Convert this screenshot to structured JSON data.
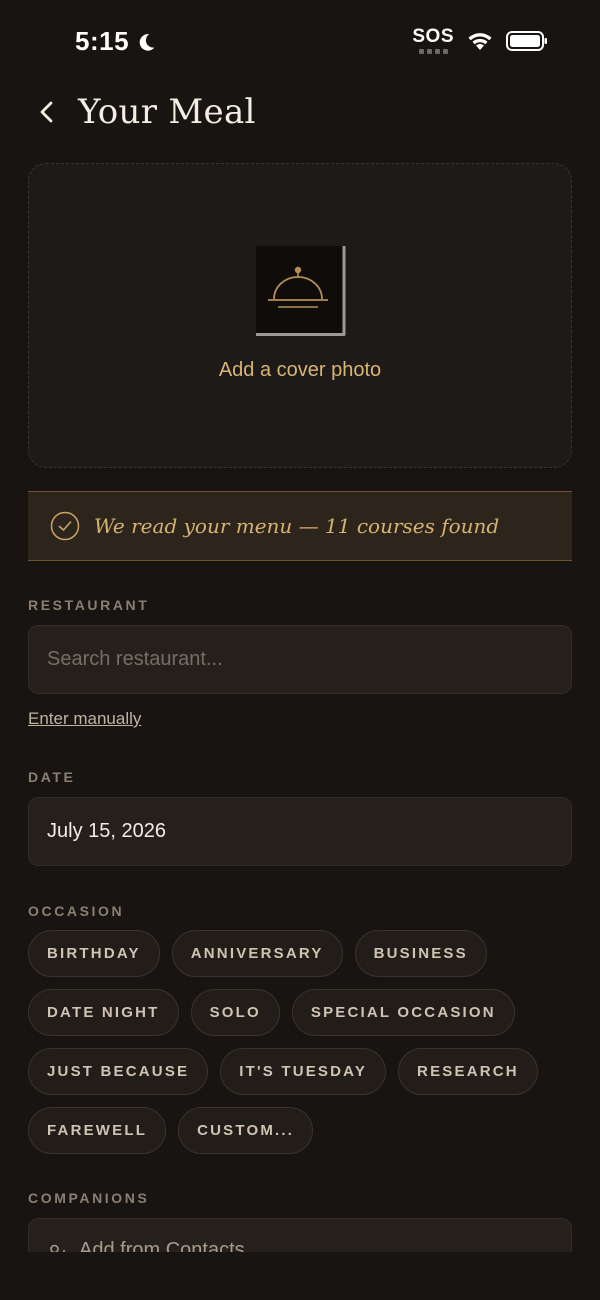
{
  "status_bar": {
    "time": "5:15",
    "sos": "SOS",
    "icons": [
      "moon-icon",
      "wifi-icon",
      "battery-icon"
    ]
  },
  "header": {
    "title": "Your Meal",
    "back_icon": "chevron-left-icon"
  },
  "cover": {
    "label": "Add a cover photo",
    "icon": "cloche-icon"
  },
  "banner": {
    "text": "We read your menu — 11 courses found",
    "icon": "check-circle-icon"
  },
  "restaurant": {
    "label": "RESTAURANT",
    "placeholder": "Search restaurant...",
    "value": "",
    "manual_link": "Enter manually"
  },
  "date": {
    "label": "DATE",
    "value": "July 15, 2026"
  },
  "occasion": {
    "label": "OCCASION",
    "rows": [
      [
        "BIRTHDAY",
        "ANNIVERSARY",
        "BUSINESS"
      ],
      [
        "DATE NIGHT",
        "SOLO",
        "SPECIAL OCCASION"
      ],
      [
        "JUST BECAUSE",
        "IT'S TUESDAY",
        "RESEARCH"
      ],
      [
        "FAREWELL",
        "CUSTOM..."
      ]
    ]
  },
  "companions": {
    "label": "COMPANIONS",
    "add_text": "Add from Contacts",
    "icon": "person-add-icon"
  },
  "colors": {
    "background": "#171411",
    "accent": "#d3b274",
    "field": "#26201c"
  }
}
